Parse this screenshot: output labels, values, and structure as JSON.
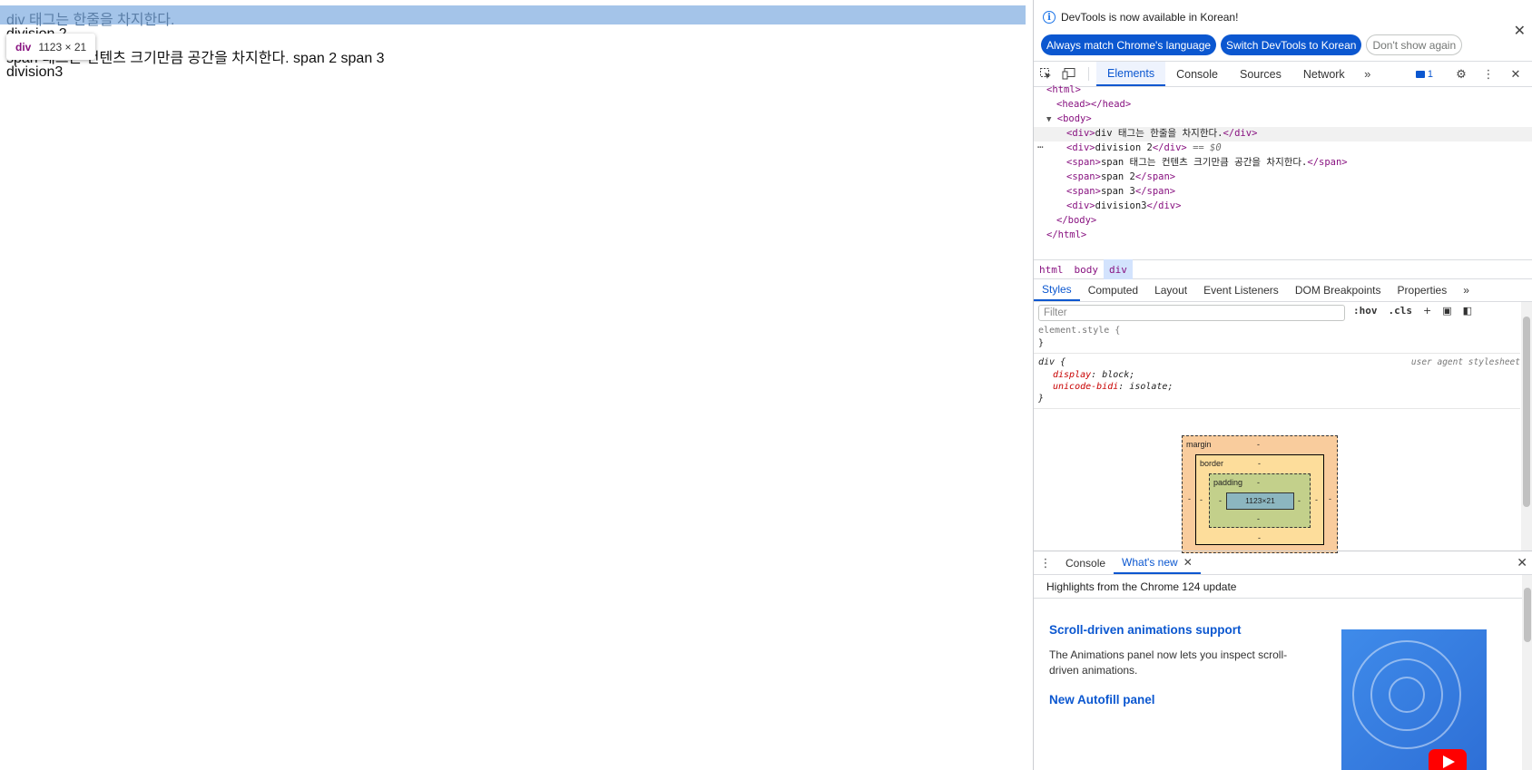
{
  "page": {
    "line1": "div 태그는 한줄을 차지한다.",
    "line2": "division 2",
    "line3": "span 태그는 컨텐츠 크기만큼 공간을 차지한다. span 2 span 3",
    "line4": "division3",
    "tooltip": {
      "tag": "div",
      "dims": "1123 × 21"
    }
  },
  "devtools": {
    "infobar": {
      "message": "DevTools is now available in Korean!",
      "btn_match": "Always match Chrome's language",
      "btn_switch": "Switch DevTools to Korean",
      "btn_dismiss": "Don't show again"
    },
    "tabs": [
      "Elements",
      "Console",
      "Sources",
      "Network"
    ],
    "issues_count": "1",
    "dom": {
      "html_open": "<html>",
      "head": "<head></head>",
      "body_open": "<body>",
      "div1_open": "<div>",
      "div1_text": "div 태그는 한줄을 차지한다.",
      "div1_close": "</div>",
      "div2_open": "<div>",
      "div2_text": "division 2",
      "div2_close": "</div>",
      "selected_marker": "== $0",
      "span1_open": "<span>",
      "span1_text": "span 태그는 컨텐츠 크기만큼 공간을 차지한다.",
      "span1_close": "</span>",
      "span2_open": "<span>",
      "span2_text": "span 2",
      "span2_close": "</span>",
      "span3_open": "<span>",
      "span3_text": "span 3",
      "span3_close": "</span>",
      "div3_open": "<div>",
      "div3_text": "division3",
      "div3_close": "</div>",
      "body_close": "</body>",
      "html_close": "</html>"
    },
    "breadcrumbs": [
      "html",
      "body",
      "div"
    ],
    "subtabs": [
      "Styles",
      "Computed",
      "Layout",
      "Event Listeners",
      "DOM Breakpoints",
      "Properties"
    ],
    "filter_placeholder": "Filter",
    "tools": {
      "hov": ":hov",
      "cls": ".cls"
    },
    "styles": {
      "element_style": "element.style {",
      "close_brace": "}",
      "div_selector": "div {",
      "source": "user agent stylesheet",
      "prop1": "display",
      "val1": "block;",
      "prop2": "unicode-bidi",
      "val2": "isolate;"
    },
    "box_model": {
      "margin_label": "margin",
      "border_label": "border",
      "padding_label": "padding",
      "content": "1123×21",
      "dash": "-"
    },
    "drawer": {
      "tabs": [
        "Console",
        "What's new"
      ],
      "header": "Highlights from the Chrome 124 update",
      "item1_title": "Scroll-driven animations support",
      "item1_text": "The Animations panel now lets you inspect scroll-driven animations.",
      "item2_title": "New Autofill panel"
    }
  }
}
